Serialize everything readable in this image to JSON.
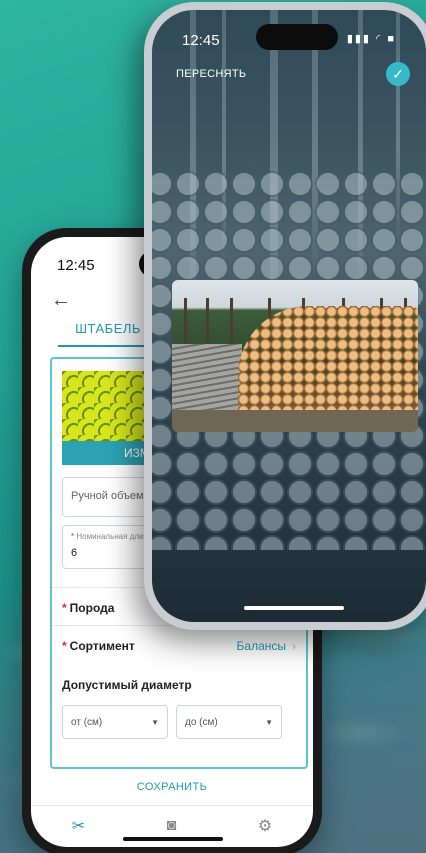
{
  "front_phone": {
    "status_time": "12:45",
    "status_icons": "▮▮▮ ◜ ■",
    "retake_label": "ПЕРЕСНЯТЬ",
    "confirm_icon": "check-icon"
  },
  "back_phone": {
    "status_time": "12:45",
    "back_icon": "arrow-left-icon",
    "tab_label": "ШТАБЕЛЬ",
    "photo_button_label": "ИЗМ",
    "manual_volume_placeholder": "Ручной объем, м",
    "nominal_length": {
      "label": "Номинальная дли",
      "value": "6"
    },
    "breed": {
      "label": "Порода"
    },
    "assortment": {
      "label": "Сортимент",
      "value": "Балансы"
    },
    "diameter": {
      "label": "Допустимый диаметр",
      "from_placeholder": "от (см)",
      "to_placeholder": "до (см)"
    },
    "save_label": "СОХРАНИТЬ",
    "nav": [
      "tools-icon",
      "camera-icon",
      "gear-icon"
    ]
  },
  "colors": {
    "accent": "#1f9aae",
    "required": "#d6312c",
    "background": "#23a496"
  }
}
